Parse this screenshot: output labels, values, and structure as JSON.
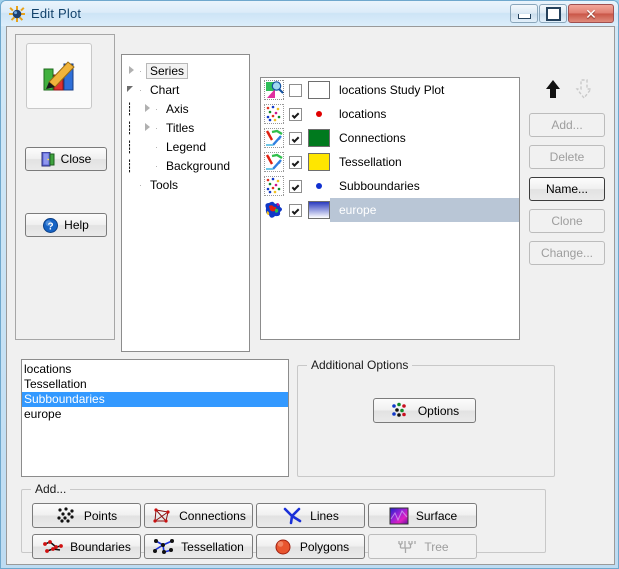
{
  "window": {
    "title": "Edit Plot",
    "icon": "app-sun-icon",
    "controls": {
      "minimize": "–",
      "maximize": "□",
      "close": "✕"
    }
  },
  "left_panel": {
    "preview_icon": "plot-edit-icon",
    "close_button": "Close",
    "help_button": "Help"
  },
  "tree": {
    "nodes": [
      {
        "label": "Series",
        "depth": 0,
        "state": "collapsed",
        "selected": true
      },
      {
        "label": "Chart",
        "depth": 0,
        "state": "expanded",
        "selected": false
      },
      {
        "label": "Axis",
        "depth": 1,
        "state": "collapsed",
        "selected": false
      },
      {
        "label": "Titles",
        "depth": 1,
        "state": "collapsed",
        "selected": false
      },
      {
        "label": "Legend",
        "depth": 1,
        "state": "leaf",
        "selected": false
      },
      {
        "label": "Background",
        "depth": 1,
        "state": "leaf",
        "selected": false
      },
      {
        "label": "Tools",
        "depth": 0,
        "state": "leaf",
        "selected": false
      }
    ]
  },
  "series_list": {
    "rows": [
      {
        "label": "locations Study Plot",
        "checked": false,
        "icon": "study-plot-icon",
        "swatch": "#ffffff",
        "swatch_type": "box",
        "selected": false
      },
      {
        "label": "locations",
        "checked": true,
        "icon": "scatter-icon",
        "swatch": "#e00000",
        "swatch_type": "dot",
        "selected": false
      },
      {
        "label": "Connections",
        "checked": true,
        "icon": "connections-icon",
        "swatch": "#007a1e",
        "swatch_type": "box",
        "selected": false
      },
      {
        "label": "Tessellation",
        "checked": true,
        "icon": "connections-icon",
        "swatch": "#ffe600",
        "swatch_type": "box",
        "selected": false
      },
      {
        "label": "Subboundaries",
        "checked": true,
        "icon": "scatter-icon",
        "swatch": "#1030d0",
        "swatch_type": "dot",
        "selected": false
      },
      {
        "label": "europe",
        "checked": true,
        "icon": "polygons-icon",
        "swatch": "#2a3bbf",
        "swatch_type": "grad",
        "selected": true
      }
    ],
    "selection_color": "#b9c6d6"
  },
  "side_buttons": {
    "move_up": "move-up-arrow",
    "move_down": "move-down-arrow",
    "move_up_enabled": true,
    "move_down_enabled": false,
    "buttons": [
      {
        "label": "Add...",
        "accel": "A",
        "enabled": false,
        "focused": false
      },
      {
        "label": "Delete",
        "accel": "D",
        "enabled": false,
        "focused": false
      },
      {
        "label": "Name...",
        "accel": "N",
        "enabled": true,
        "focused": true
      },
      {
        "label": "Clone",
        "accel": "C",
        "enabled": false,
        "focused": false
      },
      {
        "label": "Change...",
        "accel": "h",
        "enabled": false,
        "focused": false
      }
    ]
  },
  "bottom_list": {
    "items": [
      "locations",
      "Tessellation",
      "Subboundaries",
      "europe"
    ],
    "selected_index": 2,
    "selection_color": "#3399ff"
  },
  "additional_options": {
    "title": "Additional Options",
    "button_label": "Options",
    "button_icon": "colored-dots-icon"
  },
  "add_group": {
    "title": "Add...",
    "buttons": [
      {
        "label": "Points",
        "icon": "points-icon",
        "enabled": true
      },
      {
        "label": "Connections",
        "icon": "connections-icon",
        "enabled": true
      },
      {
        "label": "Lines",
        "icon": "lines-icon",
        "enabled": true
      },
      {
        "label": "Surface",
        "icon": "surface-icon",
        "enabled": true
      },
      {
        "label": "Boundaries",
        "icon": "boundaries-icon",
        "enabled": true
      },
      {
        "label": "Tessellation",
        "icon": "tessellation-icon",
        "enabled": true
      },
      {
        "label": "Polygons",
        "icon": "polygons-fill-icon",
        "enabled": true
      },
      {
        "label": "Tree",
        "icon": "tree-icon",
        "enabled": false
      }
    ]
  }
}
